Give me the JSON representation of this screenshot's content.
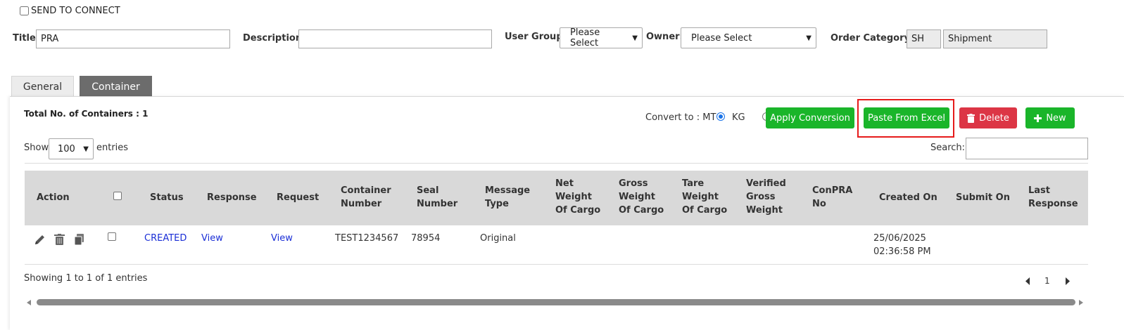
{
  "top": {
    "send_to_connect": "SEND TO CONNECT",
    "title_label": "Title:",
    "title_value": "PRA",
    "description_label": "Description:",
    "description_value": "",
    "user_group_label": "User Group:",
    "user_group_value": "Please Select",
    "owner_label": "Owner:",
    "owner_value": "Please Select",
    "order_category_label": "Order Category:",
    "order_category_code": "SH",
    "order_category_name": "Shipment"
  },
  "tabs": [
    {
      "label": "General",
      "active": false
    },
    {
      "label": "Container",
      "active": true
    }
  ],
  "panel": {
    "total_containers": "Total No. of Containers : 1",
    "convert_label": "Convert to : MT",
    "convert_kg": "KG",
    "convert_selected": "MT",
    "apply_conversion": "Apply Conversion",
    "paste_from_excel": "Paste From Excel",
    "delete": "Delete",
    "new": "New",
    "show_label": "Show",
    "entries_value": "100",
    "entries_label": "entries",
    "search_label": "Search:",
    "search_value": ""
  },
  "table": {
    "headers": {
      "action": "Action",
      "status": "Status",
      "response": "Response",
      "request": "Request",
      "container_number_1": "Container",
      "container_number_2": "Number",
      "seal_number_1": "Seal",
      "seal_number_2": "Number",
      "message_type_1": "Message",
      "message_type_2": "Type",
      "net_weight_1": "Net",
      "net_weight_2": "Weight",
      "net_weight_3": "Of Cargo",
      "gross_weight_1": "Gross",
      "gross_weight_2": "Weight",
      "gross_weight_3": "Of Cargo",
      "tare_weight_1": "Tare",
      "tare_weight_2": "Weight",
      "tare_weight_3": "Of Cargo",
      "vgm_1": "Verified",
      "vgm_2": "Gross",
      "vgm_3": "Weight",
      "conpra_1": "ConPRA",
      "conpra_2": "No",
      "created_on": "Created On",
      "submit_on": "Submit On",
      "last_response_1": "Last",
      "last_response_2": "Response"
    },
    "rows": [
      {
        "status": "CREATED",
        "response": "View",
        "request": "View",
        "container_number": "TEST1234567",
        "seal_number": "78954",
        "message_type": "Original",
        "created_on_date": "25/06/2025",
        "created_on_time": "02:36:58 PM"
      }
    ],
    "showing": "Showing 1 to 1 of 1 entries",
    "page": "1"
  },
  "colors": {
    "green": "#1ab52a",
    "red": "#dc3545",
    "link": "#1a2ed6",
    "highlight": "#e61b1b"
  }
}
